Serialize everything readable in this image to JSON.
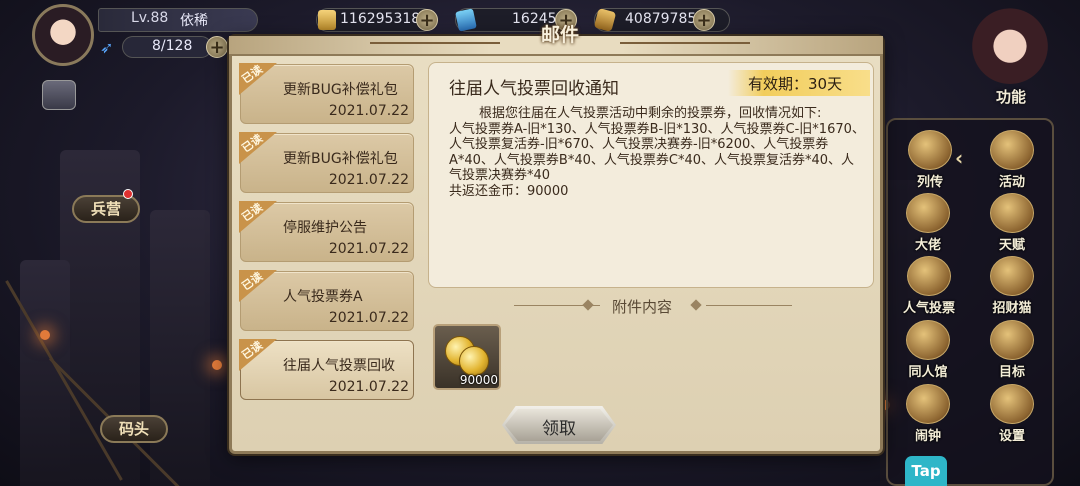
{
  "player": {
    "level": "Lv.88",
    "name": "依稀",
    "stamina": "8/128"
  },
  "resources": [
    {
      "icon": "gold-ingot-icon",
      "value": "116295318"
    },
    {
      "icon": "blue-ticket-icon",
      "value": "16245"
    },
    {
      "icon": "gold-coin-icon",
      "value": "40879785"
    }
  ],
  "function_button": {
    "label": "功能"
  },
  "function_menu": [
    {
      "label": "列传",
      "icon": "book-icon"
    },
    {
      "label": "活动",
      "icon": "star-medal-icon"
    },
    {
      "label": "大佬",
      "icon": "boss-icon"
    },
    {
      "label": "天赋",
      "icon": "eagle-crest-icon"
    },
    {
      "label": "人气投票",
      "icon": "vote-icon"
    },
    {
      "label": "招财猫",
      "icon": "lucky-cat-icon"
    },
    {
      "label": "同人馆",
      "icon": "gallery-icon"
    },
    {
      "label": "目标",
      "icon": "target-shield-icon"
    },
    {
      "label": "闹钟",
      "icon": "alarm-clock-icon"
    },
    {
      "label": "设置",
      "icon": "gear-icon"
    }
  ],
  "tap_button": {
    "label": "Tap"
  },
  "side": {
    "barracks_label": "兵营",
    "dock_label": "码头"
  },
  "dialog": {
    "title": "邮件",
    "read_tag": "已读",
    "mails": [
      {
        "title": "更新BUG补偿礼包",
        "date": "2021.07.22",
        "selected": false
      },
      {
        "title": "更新BUG补偿礼包",
        "date": "2021.07.22",
        "selected": false
      },
      {
        "title": "停服维护公告",
        "date": "2021.07.22",
        "selected": false
      },
      {
        "title": "人气投票券A",
        "date": "2021.07.22",
        "selected": false
      },
      {
        "title": "往届人气投票回收",
        "date": "2021.07.22",
        "selected": true
      }
    ],
    "detail": {
      "title": "往届人气投票回收通知",
      "validity": "有效期：30天",
      "paragraph1": "根据您往届在人气投票活动中剩余的投票券，回收情况如下:",
      "paragraph2": "人气投票券A-旧*130、人气投票券B-旧*130、人气投票券C-旧*1670、人气投票复活券-旧*670、人气投票决赛券-旧*6200、人气投票券A*40、人气投票券B*40、人气投票券C*40、人气投票复活券*40、人气投票决赛券*40",
      "paragraph3": "共返还金币：90000"
    },
    "attachments_title": "附件内容",
    "attachments": [
      {
        "icon": "gold-coins-icon",
        "count": "90000"
      }
    ],
    "claim_label": "领取"
  }
}
